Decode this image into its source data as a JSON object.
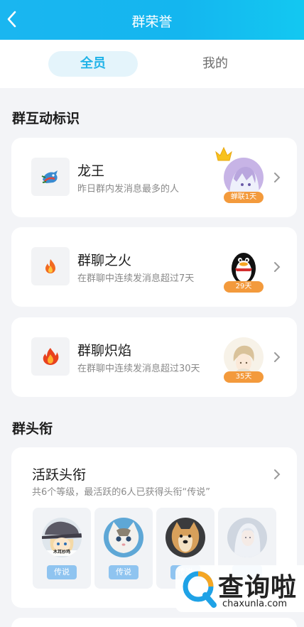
{
  "header": {
    "title": "群荣誉"
  },
  "tabs": [
    {
      "label": "全员",
      "active": true
    },
    {
      "label": "我的",
      "active": false
    }
  ],
  "section_interaction": {
    "title": "群互动标识"
  },
  "badges": [
    {
      "name": "龙王",
      "desc": "昨日群内发消息最多的人",
      "days": "蝉联1天",
      "icon": "dragon-icon",
      "has_crown": true
    },
    {
      "name": "群聊之火",
      "desc": "在群聊中连续发消息超过7天",
      "days": "29天",
      "icon": "fire-icon",
      "has_crown": false
    },
    {
      "name": "群聊炽焰",
      "desc": "在群聊中连续发消息超过30天",
      "days": "35天",
      "icon": "flame-icon",
      "has_crown": false
    }
  ],
  "section_titles": {
    "title": "群头衔"
  },
  "active_title": {
    "name": "活跃头衔",
    "desc": "共6个等级，最活跃的6人已获得头衔“传说”",
    "members": [
      {
        "avatar_caption": "木耳炒鸡",
        "badge": "传说"
      },
      {
        "badge": "传说"
      },
      {
        "badge": "传说"
      },
      {
        "badge": ""
      }
    ]
  },
  "watermark": {
    "text": "查询啦",
    "url": "chaxunla.com"
  },
  "colors": {
    "accent": "#21b3e8",
    "header": "#14b6ef",
    "badge_orange": "#f39a3c",
    "title_badge": "#8fc4f0"
  }
}
